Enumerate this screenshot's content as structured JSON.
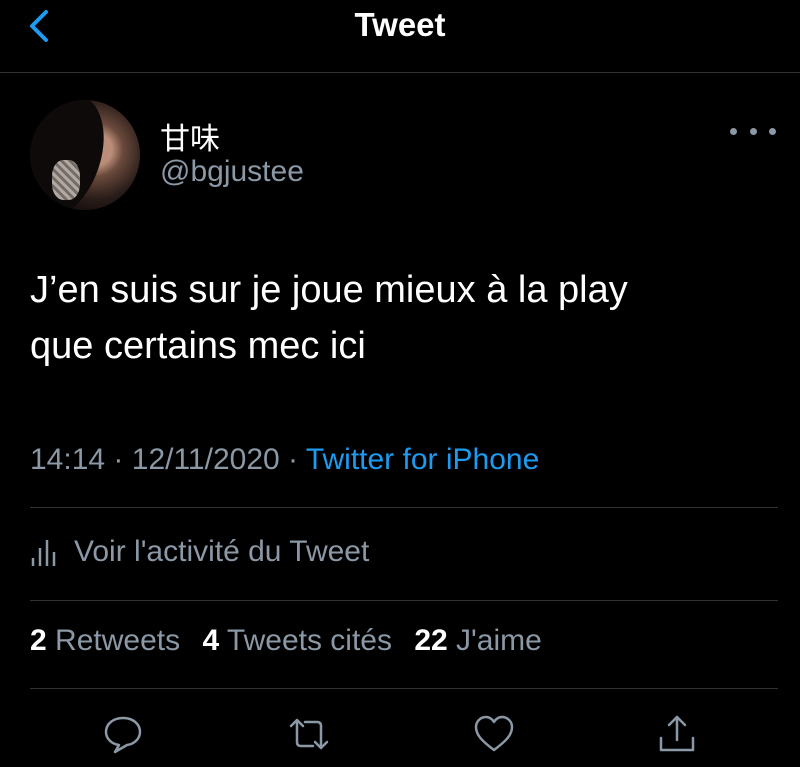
{
  "header": {
    "title": "Tweet",
    "back_icon": "chevron-left-icon",
    "accent": "#1d9bf0"
  },
  "author": {
    "display_name": "甘味",
    "handle": "@bgjustee",
    "avatar": "profile-photo"
  },
  "tweet": {
    "lines": [
      "J’en suis sur je joue mieux à la play",
      "que certains mec ici"
    ],
    "time": "14:14",
    "separator": "·",
    "date": "12/11/2020",
    "source": "Twitter for iPhone"
  },
  "activity": {
    "label": "Voir l'activité du Tweet",
    "icon": "bar-chart-icon"
  },
  "stats": {
    "retweets_count": "2",
    "retweets_label": "Retweets",
    "quotes_count": "4",
    "quotes_label": "Tweets cités",
    "likes_count": "22",
    "likes_label": "J'aime"
  },
  "actions": [
    "reply-icon",
    "retweet-icon",
    "like-icon",
    "share-icon"
  ],
  "colors": {
    "background": "#000000",
    "text": "#ffffff",
    "secondary": "#8b98a5",
    "divider": "#2f3336"
  }
}
